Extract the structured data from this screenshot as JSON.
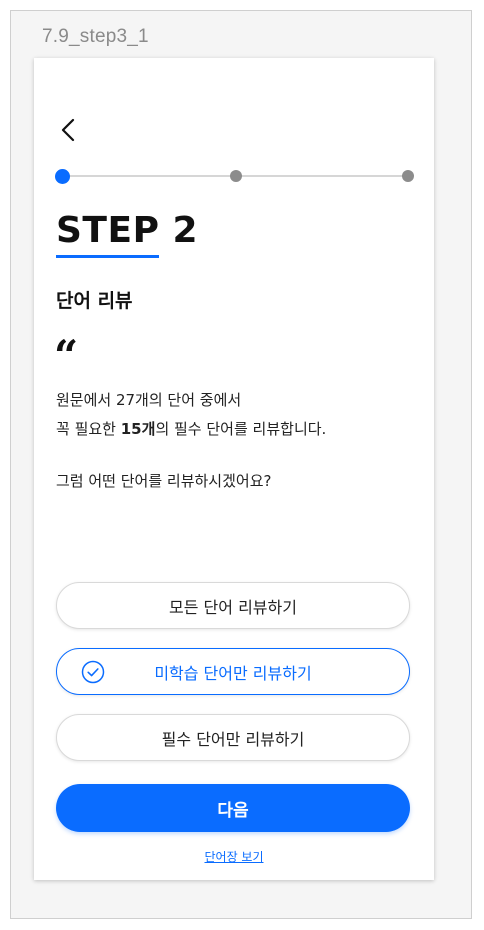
{
  "frame": {
    "label": "7.9_step3_1"
  },
  "colors": {
    "accent": "#0a6cff",
    "text": "#111111",
    "inactive_dot": "#8c8c8c"
  },
  "progress": {
    "total_steps": 3,
    "current_step": 1
  },
  "header": {
    "step_word": "STEP",
    "step_number": "2",
    "subtitle": "단어 리뷰"
  },
  "content": {
    "quote_mark": "“",
    "line1": "원문에서 27개의 단어 중에서",
    "line2_prefix": "꼭 필요한 ",
    "line2_bold": "15개",
    "line2_suffix": "의 필수 단어를 리뷰합니다.",
    "question": "그럼 어떤 단어를 리뷰하시겠어요?"
  },
  "options": [
    {
      "label": "모든 단어 리뷰하기",
      "selected": false
    },
    {
      "label": "미학습 단어만 리뷰하기",
      "selected": true
    },
    {
      "label": "필수 단어만 리뷰하기",
      "selected": false
    }
  ],
  "actions": {
    "next_label": "다음",
    "vocab_link": "단어장 보기"
  }
}
